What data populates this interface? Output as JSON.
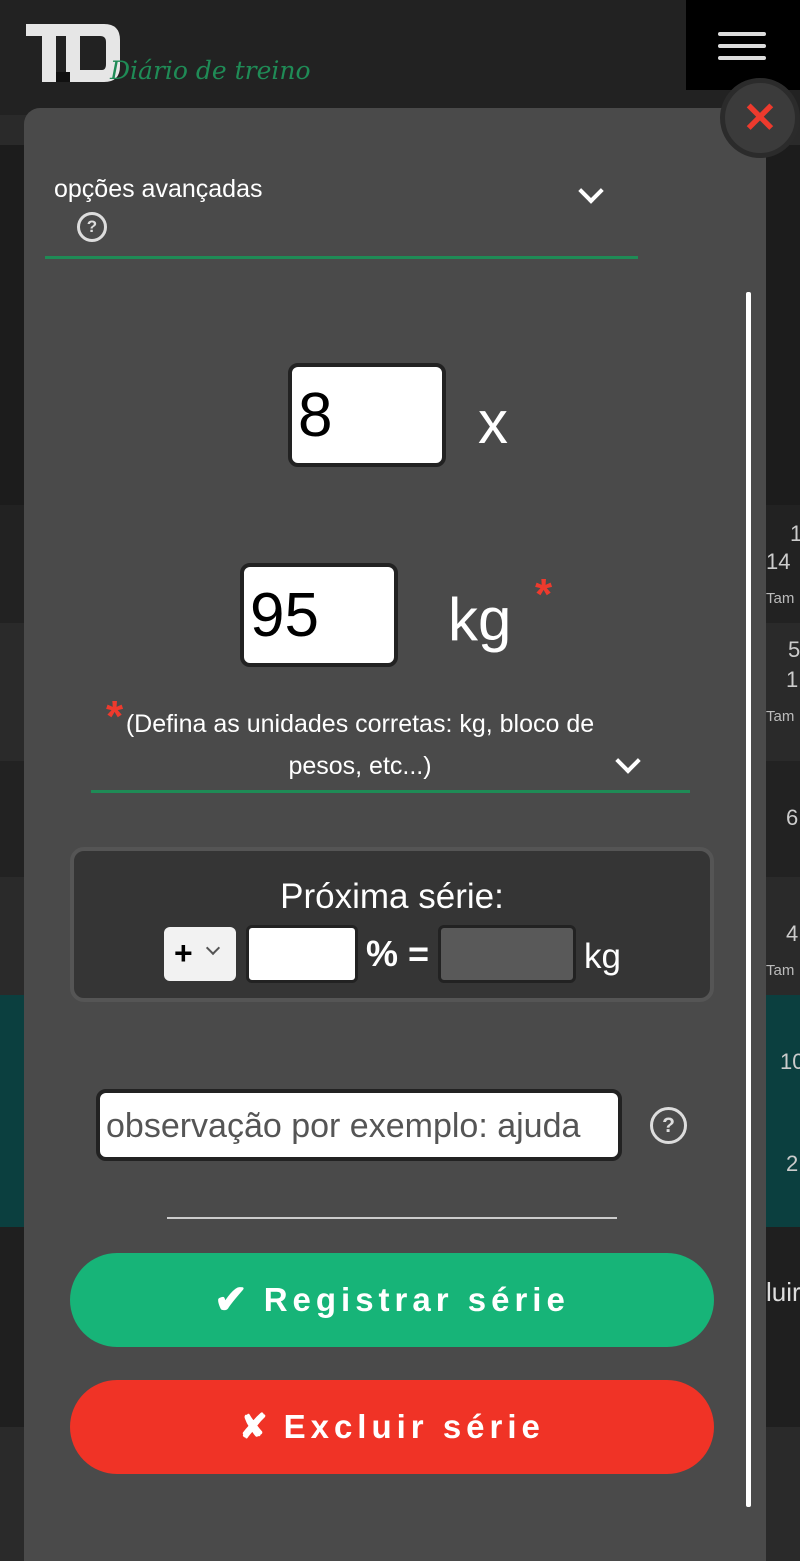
{
  "header": {
    "logo_text": "TD",
    "subtitle": "Diário de treino"
  },
  "background_rows": [
    {
      "line1": "1",
      "line2": "14",
      "line3": "Tam"
    },
    {
      "line1": "5",
      "line2": "1",
      "line3": "Tam"
    },
    {
      "line1": "6"
    },
    {
      "line1": "4",
      "line3": "Tam"
    },
    {
      "line1": "10"
    },
    {
      "line1": "2"
    },
    {
      "line1": "luir"
    }
  ],
  "modal": {
    "advanced_options_label": "opções avançadas",
    "reps": {
      "value": "8",
      "separator": "x"
    },
    "weight": {
      "value": "95",
      "unit": "kg",
      "required_mark": "*"
    },
    "unit_hint": {
      "required_mark": "*",
      "text": "(Defina as unidades corretas: kg, bloco de pesos, etc...)"
    },
    "next_series": {
      "title": "Próxima série:",
      "sign": "+",
      "percent_value": "",
      "equals": "% =",
      "result_value": "",
      "unit": "kg"
    },
    "observation": {
      "placeholder": "observação por exemplo: ajuda",
      "value": ""
    },
    "register_button": {
      "icon": "✔",
      "label": "Registrar série"
    },
    "delete_button": {
      "icon": "✘",
      "label": "Excluir série"
    }
  },
  "colors": {
    "accent_green": "#17b478",
    "danger_red": "#f03326",
    "modal_bg": "#4a4a4a",
    "brand_green": "#1f8b56"
  }
}
